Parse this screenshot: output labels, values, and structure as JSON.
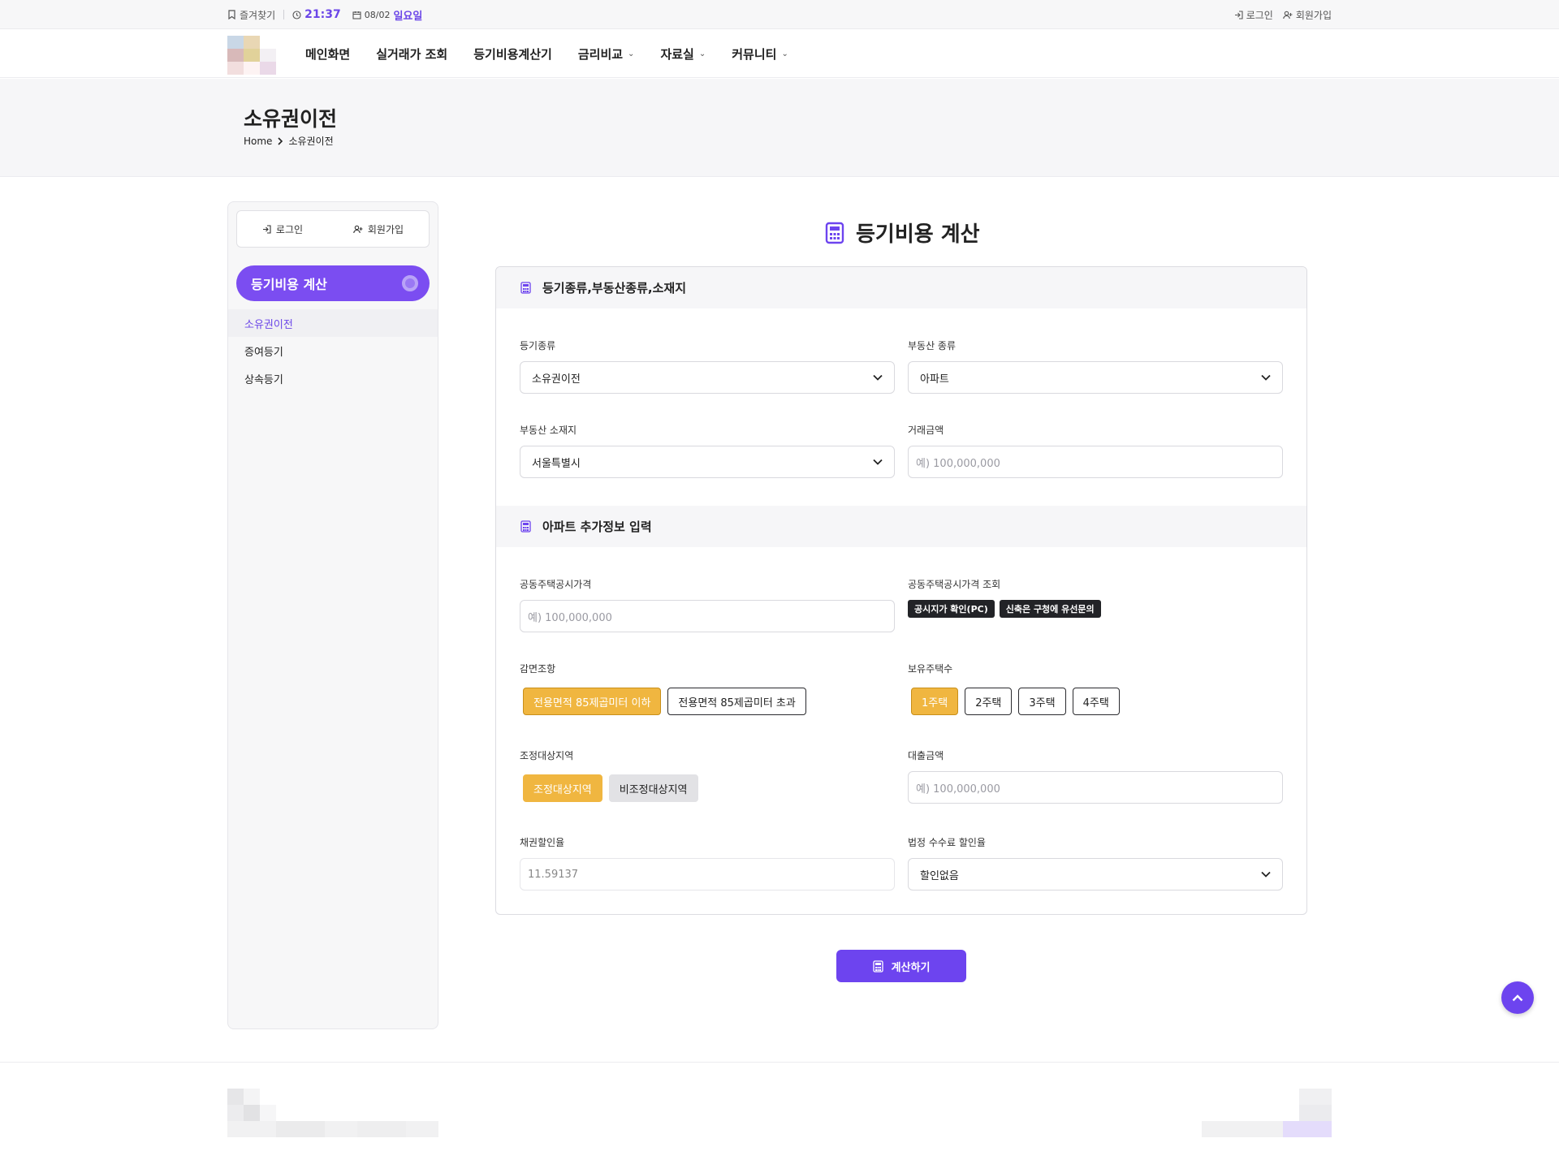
{
  "topbar": {
    "bookmark_label": "즐겨찾기",
    "time": "21:37",
    "date": "08/02",
    "day": "일요일",
    "login_label": "로그인",
    "signup_label": "회원가입"
  },
  "nav": {
    "items": [
      {
        "label": "메인화면",
        "dropdown": false
      },
      {
        "label": "실거래가 조회",
        "dropdown": false
      },
      {
        "label": "등기비용계산기",
        "dropdown": false
      },
      {
        "label": "금리비교",
        "dropdown": true
      },
      {
        "label": "자료실",
        "dropdown": true
      },
      {
        "label": "커뮤니티",
        "dropdown": true
      }
    ]
  },
  "page": {
    "title": "소유권이전",
    "breadcrumb_home": "Home",
    "breadcrumb_current": "소유권이전"
  },
  "sidebar": {
    "login_label": "로그인",
    "signup_label": "회원가입",
    "active_label": "등기비용 계산",
    "links": [
      "소유권이전",
      "증여등기",
      "상속등기"
    ]
  },
  "main": {
    "title": "등기비용 계산",
    "section1_title": "등기종류,부동산종류,소재지",
    "section2_title": "아파트 추가정보 입력",
    "fields": {
      "registration_type_label": "등기종류",
      "registration_type_value": "소유권이전",
      "property_type_label": "부동산 종류",
      "property_type_value": "아파트",
      "location_label": "부동산 소재지",
      "location_value": "서울특별시",
      "trade_amount_label": "거래금액",
      "trade_amount_placeholder": "예) 100,000,000",
      "public_price_label": "공동주택공시가격",
      "public_price_placeholder": "예) 100,000,000",
      "public_price_lookup_label": "공동주택공시가격 조회",
      "lookup_btn_1": "공시지가 확인(PC)",
      "lookup_btn_2": "신축은 구청에 유선문의",
      "reduction_label": "감면조항",
      "reduction_opt_1": "전용면적 85제곱미터 이하",
      "reduction_opt_2": "전용면적 85제곱미터 초과",
      "houses_label": "보유주택수",
      "houses_opts": [
        "1주택",
        "2주택",
        "3주택",
        "4주택"
      ],
      "regulated_label": "조정대상지역",
      "regulated_opt_1": "조정대상지역",
      "regulated_opt_2": "비조정대상지역",
      "loan_label": "대출금액",
      "loan_placeholder": "예) 100,000,000",
      "bond_rate_label": "채권할인율",
      "bond_rate_value": "11.59137",
      "fee_discount_label": "법정 수수료 할인율",
      "fee_discount_value": "할인없음"
    },
    "calc_button": "계산하기"
  },
  "colors": {
    "accent": "#6d44ef",
    "selected": "#f0b640"
  }
}
